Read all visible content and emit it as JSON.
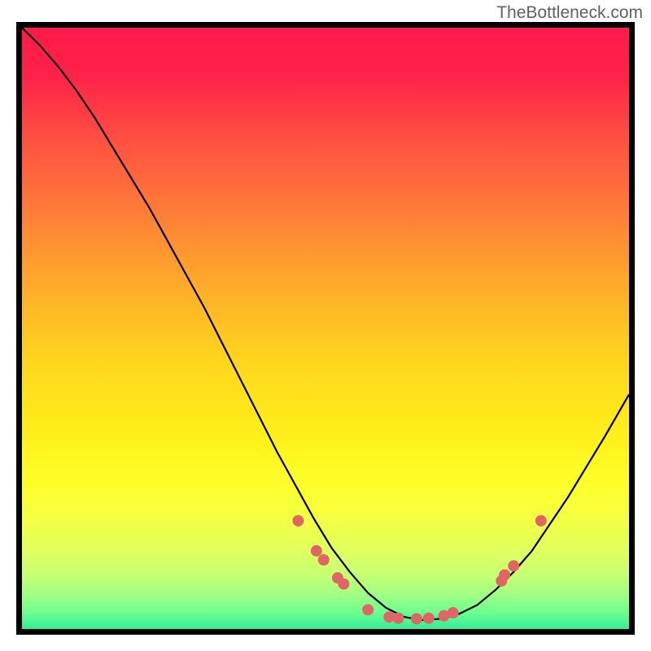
{
  "watermark": "TheBottleneck.com",
  "chart_data": {
    "type": "line",
    "title": "",
    "xlabel": "",
    "ylabel": "",
    "xlim": [
      0,
      100
    ],
    "ylim": [
      0,
      100
    ],
    "curve": {
      "x": [
        0,
        3,
        6,
        9,
        12,
        15,
        18,
        21,
        24,
        27,
        30,
        33,
        36,
        39,
        42,
        45,
        48,
        51,
        54,
        57,
        60,
        63,
        66,
        69,
        72,
        75,
        78,
        81,
        84,
        87,
        90,
        93,
        96,
        100
      ],
      "y": [
        100,
        97,
        93.5,
        89.5,
        85,
        80,
        75,
        70,
        64.5,
        59,
        53.5,
        47.5,
        41.5,
        35.5,
        29.5,
        24,
        18.5,
        13.5,
        9.5,
        6,
        3.5,
        2,
        1.5,
        1.7,
        2.5,
        4,
        6.5,
        9.5,
        13,
        17.5,
        22,
        27,
        32,
        39
      ]
    },
    "points": [
      {
        "x": 45.5,
        "y": 18
      },
      {
        "x": 48.5,
        "y": 13
      },
      {
        "x": 49.7,
        "y": 11.5
      },
      {
        "x": 52,
        "y": 8.5
      },
      {
        "x": 53,
        "y": 7.5
      },
      {
        "x": 57,
        "y": 3.2
      },
      {
        "x": 60.5,
        "y": 2.0
      },
      {
        "x": 62,
        "y": 1.8
      },
      {
        "x": 65,
        "y": 1.7
      },
      {
        "x": 67,
        "y": 1.8
      },
      {
        "x": 69.5,
        "y": 2.2
      },
      {
        "x": 71,
        "y": 2.7
      },
      {
        "x": 79,
        "y": 8
      },
      {
        "x": 79.5,
        "y": 9
      },
      {
        "x": 81,
        "y": 10.5
      },
      {
        "x": 85.5,
        "y": 18
      }
    ],
    "gradient_stops": [
      {
        "pos": 0,
        "color": "#ff1a4a"
      },
      {
        "pos": 8,
        "color": "#ff2249"
      },
      {
        "pos": 18,
        "color": "#ff4d42"
      },
      {
        "pos": 30,
        "color": "#ff7a38"
      },
      {
        "pos": 42,
        "color": "#ffa82b"
      },
      {
        "pos": 55,
        "color": "#ffd41e"
      },
      {
        "pos": 68,
        "color": "#fff019"
      },
      {
        "pos": 76,
        "color": "#fdff2a"
      },
      {
        "pos": 82,
        "color": "#f2ff44"
      },
      {
        "pos": 87,
        "color": "#e0ff5e"
      },
      {
        "pos": 91,
        "color": "#c6ff73"
      },
      {
        "pos": 94,
        "color": "#a4ff82"
      },
      {
        "pos": 97,
        "color": "#71ff8e"
      },
      {
        "pos": 100,
        "color": "#34ec97"
      }
    ],
    "point_style": {
      "radius": 7,
      "fill": "#e06666"
    },
    "line_style": {
      "stroke": "#000000",
      "width": 2.2
    }
  }
}
